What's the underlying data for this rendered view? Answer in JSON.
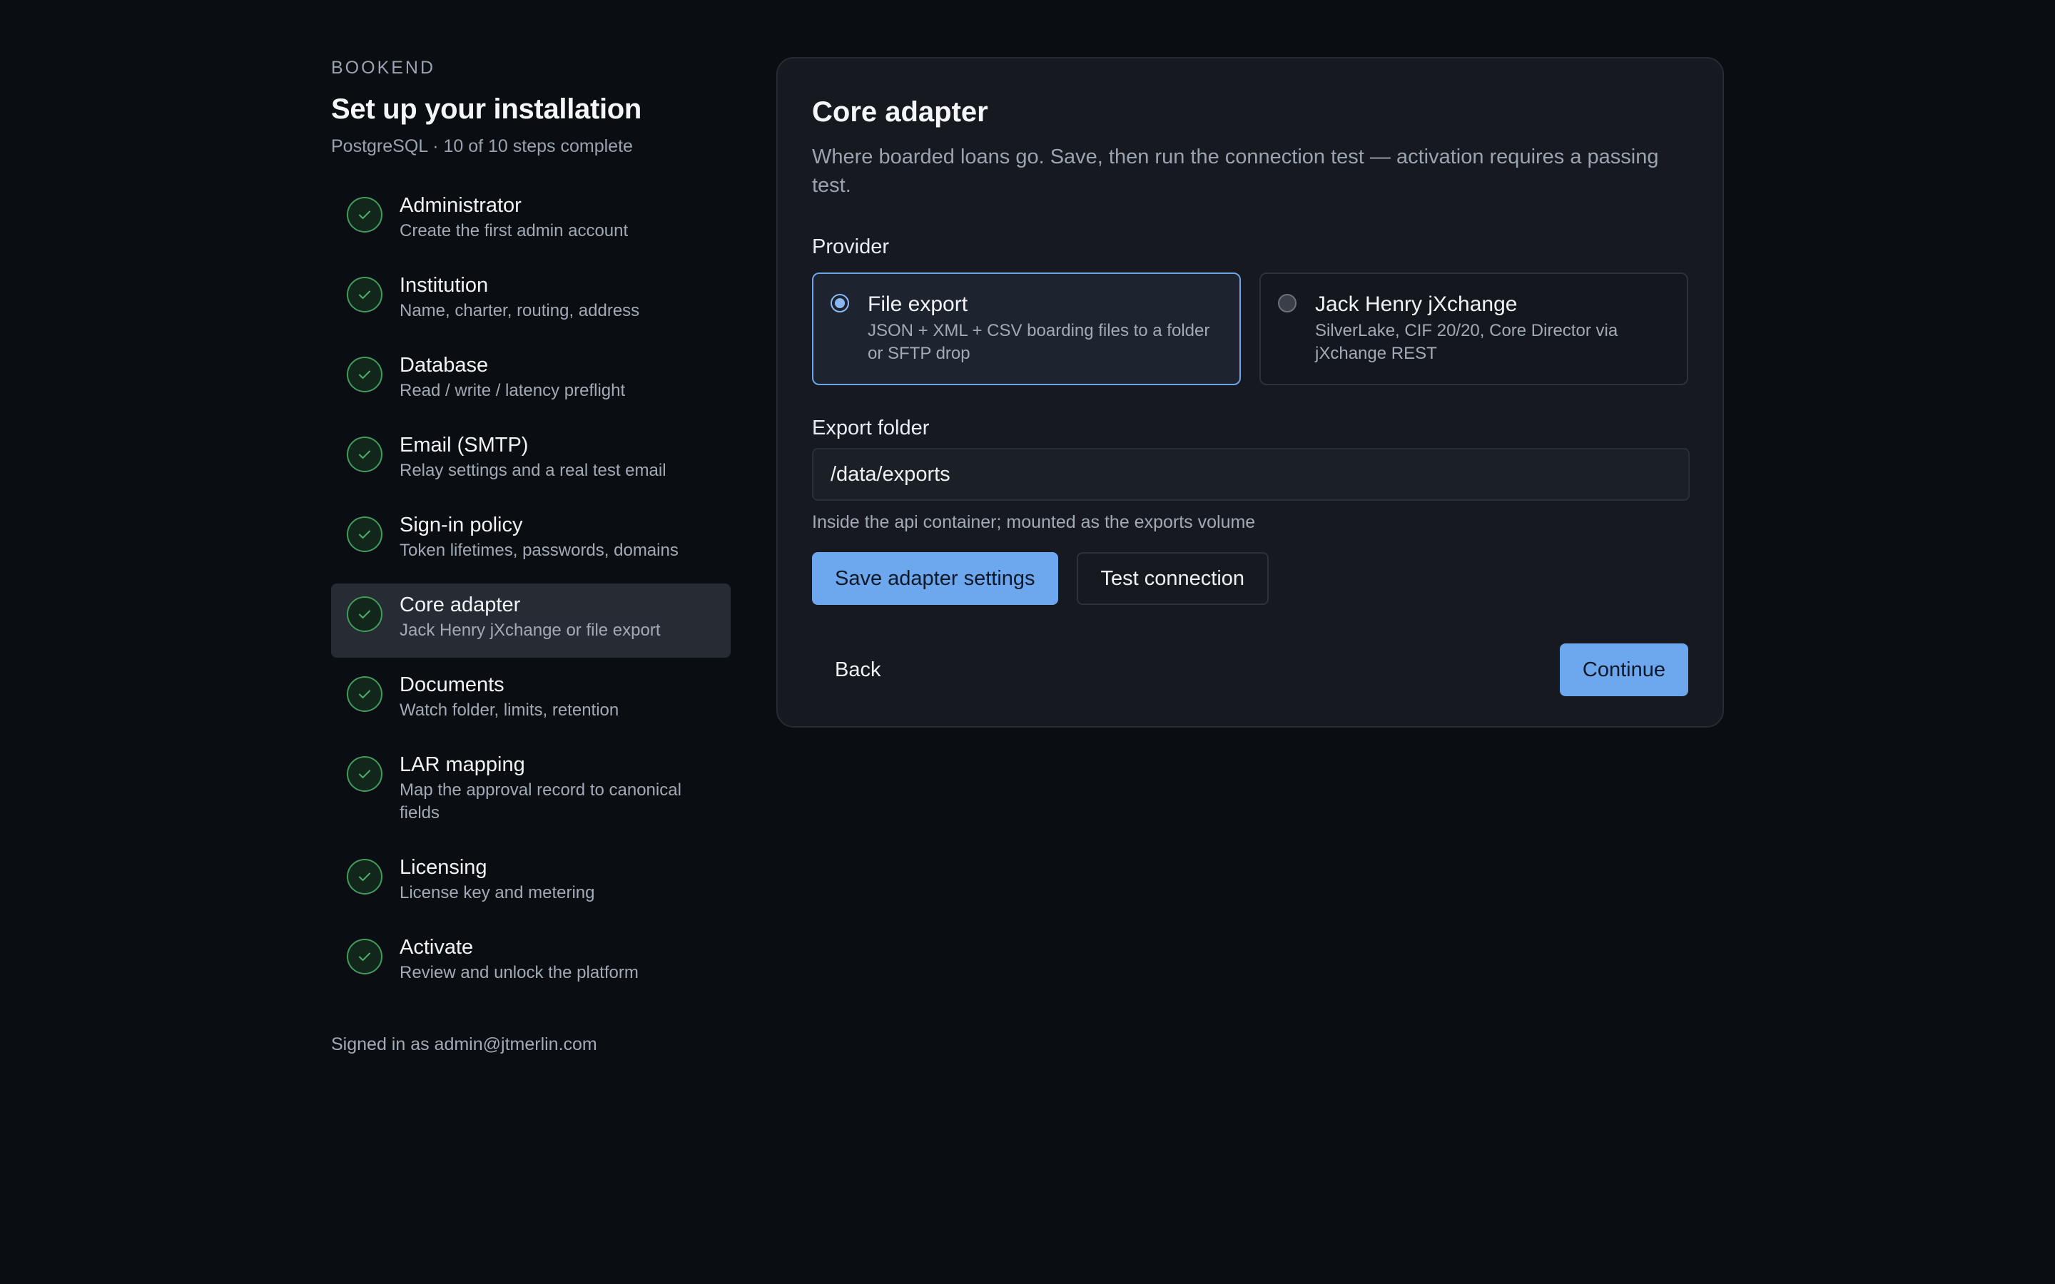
{
  "sidebar": {
    "brand": "BOOKEND",
    "title": "Set up your installation",
    "subtitle": "PostgreSQL · 10 of 10 steps complete",
    "steps": [
      {
        "title": "Administrator",
        "desc": "Create the first admin account",
        "status": "complete"
      },
      {
        "title": "Institution",
        "desc": "Name, charter, routing, address",
        "status": "complete"
      },
      {
        "title": "Database",
        "desc": "Read / write / latency preflight",
        "status": "complete"
      },
      {
        "title": "Email (SMTP)",
        "desc": "Relay settings and a real test email",
        "status": "complete"
      },
      {
        "title": "Sign-in policy",
        "desc": "Token lifetimes, passwords, domains",
        "status": "complete"
      },
      {
        "title": "Core adapter",
        "desc": "Jack Henry jXchange or file export",
        "status": "complete",
        "active": true
      },
      {
        "title": "Documents",
        "desc": "Watch folder, limits, retention",
        "status": "complete"
      },
      {
        "title": "LAR mapping",
        "desc": "Map the approval record to canonical fields",
        "status": "complete"
      },
      {
        "title": "Licensing",
        "desc": "License key and metering",
        "status": "complete"
      },
      {
        "title": "Activate",
        "desc": "Review and unlock the platform",
        "status": "complete"
      }
    ],
    "signed_in": "Signed in as admin@jtmerlin.com"
  },
  "card": {
    "title": "Core adapter",
    "description": "Where boarded loans go. Save, then run the connection test — activation requires a passing test.",
    "provider_label": "Provider",
    "providers": [
      {
        "name": "File export",
        "desc": "JSON + XML + CSV boarding files to a folder or SFTP drop",
        "selected": true
      },
      {
        "name": "Jack Henry jXchange",
        "desc": "SilverLake, CIF 20/20, Core Director via jXchange REST",
        "selected": false
      }
    ],
    "folder_label": "Export folder",
    "folder_value": "/data/exports",
    "folder_hint": "Inside the api container; mounted as the exports volume",
    "save_label": "Save adapter settings",
    "test_label": "Test connection",
    "back_label": "Back",
    "continue_label": "Continue"
  },
  "colors": {
    "accent": "#6da7ee",
    "success": "#3f9d5c",
    "background": "#0a0d12",
    "card": "#161a20"
  }
}
